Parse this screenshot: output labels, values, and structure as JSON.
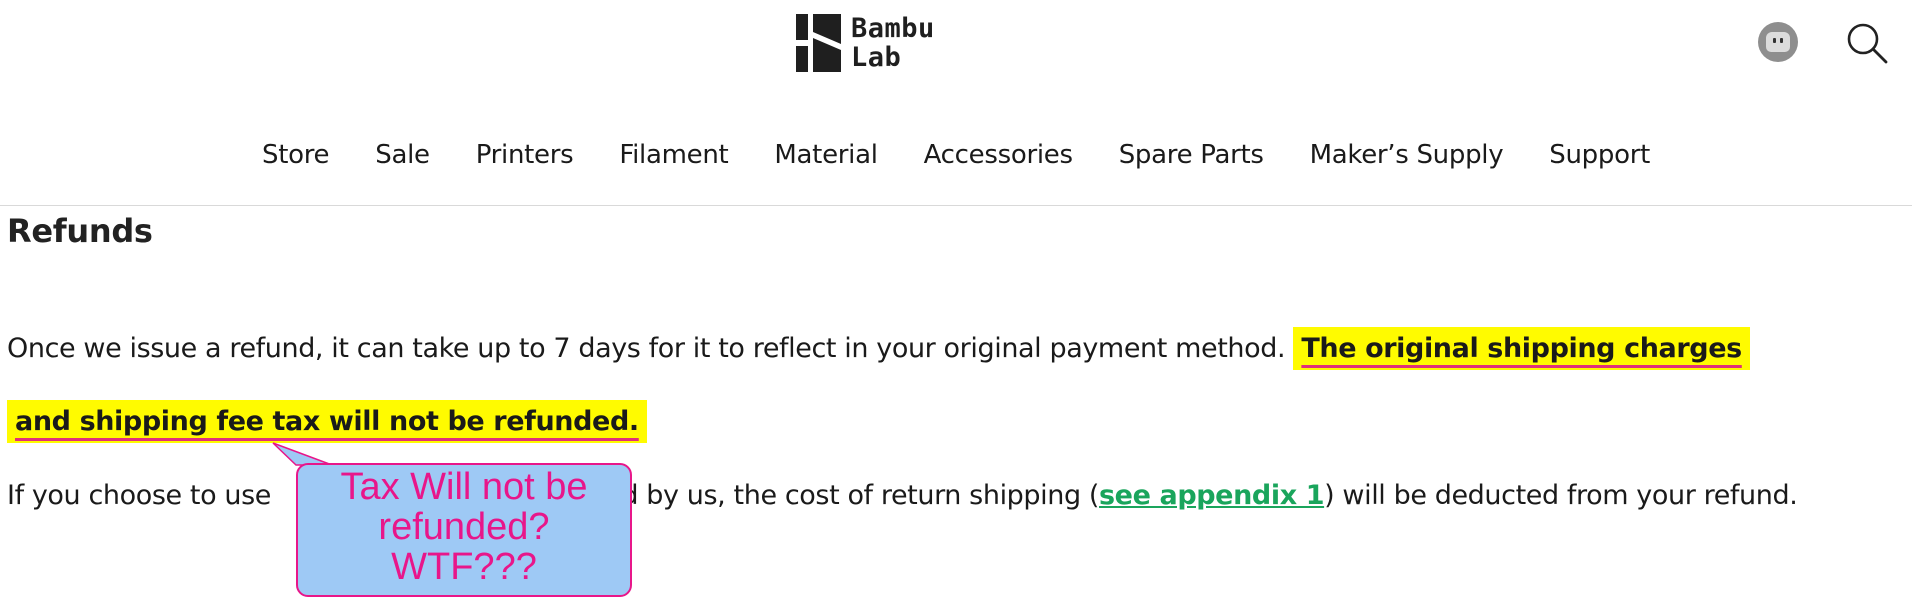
{
  "header": {
    "logo": {
      "line1": "Bambu",
      "line2": "Lab"
    },
    "icons": {
      "account": "robot-avatar-icon",
      "search": "search-icon"
    }
  },
  "nav": {
    "items": [
      {
        "label": "Store"
      },
      {
        "label": "Sale"
      },
      {
        "label": "Printers"
      },
      {
        "label": "Filament"
      },
      {
        "label": "Material"
      },
      {
        "label": "Accessories"
      },
      {
        "label": "Spare Parts"
      },
      {
        "label": "Maker’s Supply"
      },
      {
        "label": "Support"
      }
    ]
  },
  "main": {
    "heading": "Refunds",
    "para1_plain": "Once we issue a refund, it can take up to 7 days for it to reflect in your original payment method. ",
    "para1_highlight_a": "The original shipping charges",
    "para1_highlight_b": "and shipping fee tax will not be refunded.",
    "para2_start": "If you choose to use ",
    "para2_mid": "ed by us, the cost of return shipping (",
    "para2_link": "see appendix 1",
    "para2_end": ") will be deducted from your refund."
  },
  "annotation": {
    "line1": "Tax Will not be",
    "line2": "refunded?",
    "line3": "WTF???"
  },
  "colors": {
    "highlight": "#fffb00",
    "underline": "#e0307a",
    "link": "#1aa55c",
    "callout_bg": "#9ec9f5",
    "callout_text": "#e8168a"
  }
}
